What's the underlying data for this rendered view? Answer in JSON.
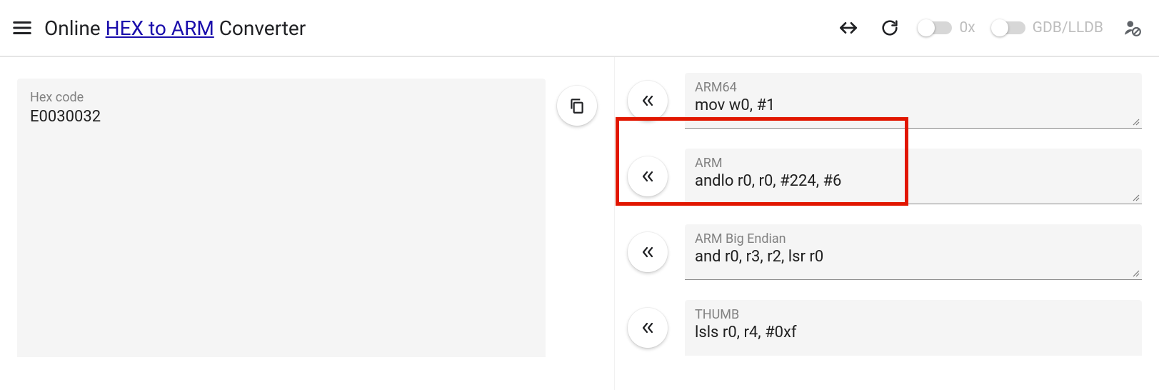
{
  "header": {
    "title_prefix": "Online ",
    "title_link": "HEX to ARM",
    "title_suffix": " Converter",
    "toggle_0x_label": "0x",
    "toggle_gdb_label": "GDB/LLDB"
  },
  "hex": {
    "label": "Hex code",
    "value": "E0030032"
  },
  "results": [
    {
      "arch": "ARM64",
      "asm": "mov w0, #1"
    },
    {
      "arch": "ARM",
      "asm": "andlo r0, r0, #224, #6"
    },
    {
      "arch": "ARM Big Endian",
      "asm": "and r0, r3, r2, lsr r0"
    },
    {
      "arch": "THUMB",
      "asm": "lsls r0, r4, #0xf"
    }
  ]
}
